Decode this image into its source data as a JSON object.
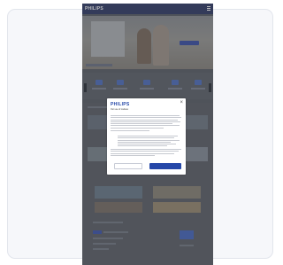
{
  "site": {
    "logo": "PHILIPS"
  },
  "consent_modal": {
    "brand": "PHILIPS",
    "title": "Our use of cookies",
    "close_symbol": "×",
    "secondary_button": "",
    "primary_button": ""
  },
  "colors": {
    "brand_blue": "#2547a8",
    "header_navy": "#2e3a66",
    "scrim": "#5a5e66"
  },
  "icons": {
    "menu": "hamburger-icon",
    "close": "close-icon",
    "carousel_prev": "chevron-left-icon",
    "carousel_next": "chevron-right-icon"
  }
}
